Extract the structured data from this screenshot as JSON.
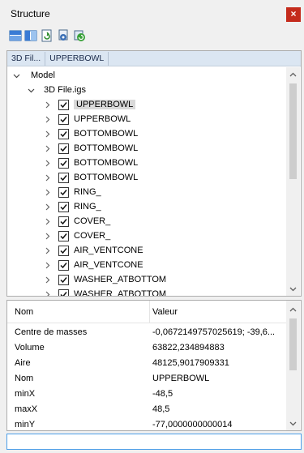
{
  "window": {
    "title": "Structure",
    "close_glyph": "×"
  },
  "toolbar": {
    "icons": [
      "horizontal-split-icon",
      "vertical-split-icon",
      "refresh-icon",
      "document-settings-icon",
      "refresh-green-icon"
    ]
  },
  "breadcrumb": {
    "items": [
      "3D Fil...",
      "UPPERBOWL"
    ]
  },
  "tree": {
    "root": "Model",
    "file": "3D File.igs",
    "items": [
      "UPPERBOWL",
      "UPPERBOWL",
      "BOTTOMBOWL",
      "BOTTOMBOWL",
      "BOTTOMBOWL",
      "BOTTOMBOWL",
      "RING_",
      "RING_",
      "COVER_",
      "COVER_",
      "AIR_VENTCONE",
      "AIR_VENTCONE",
      "WASHER_ATBOTTOM",
      "WASHER_ATBOTTOM"
    ],
    "selected_index": 0
  },
  "properties": {
    "col_name": "Nom",
    "col_value": "Valeur",
    "rows": [
      {
        "key": "Centre de masses",
        "value": "-0,0672149757025619; -39,6..."
      },
      {
        "key": "Volume",
        "value": "63822,234894883"
      },
      {
        "key": "Aire",
        "value": "48125,9017909331"
      },
      {
        "key": "Nom",
        "value": "UPPERBOWL"
      },
      {
        "key": "minX",
        "value": "-48,5"
      },
      {
        "key": "maxX",
        "value": "48,5"
      },
      {
        "key": "minY",
        "value": "-77,0000000000014"
      }
    ]
  },
  "search": {
    "value": "",
    "placeholder": ""
  }
}
